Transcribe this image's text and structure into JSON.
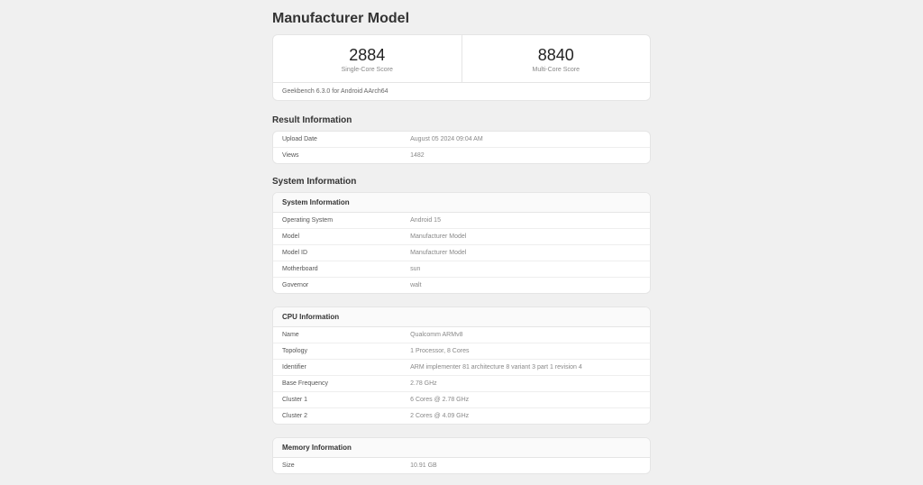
{
  "title": "Manufacturer Model",
  "scores": {
    "single_core": {
      "value": "2884",
      "label": "Single-Core Score"
    },
    "multi_core": {
      "value": "8840",
      "label": "Multi-Core Score"
    }
  },
  "version_text": "Geekbench 6.3.0 for Android AArch64",
  "sections": {
    "result": {
      "title": "Result Information",
      "rows": [
        {
          "label": "Upload Date",
          "value": "August 05 2024 09:04 AM"
        },
        {
          "label": "Views",
          "value": "1482"
        }
      ]
    },
    "system": {
      "title": "System Information",
      "header": "System Information",
      "rows": [
        {
          "label": "Operating System",
          "value": "Android 15"
        },
        {
          "label": "Model",
          "value": "Manufacturer Model"
        },
        {
          "label": "Model ID",
          "value": "Manufacturer Model"
        },
        {
          "label": "Motherboard",
          "value": "sun"
        },
        {
          "label": "Governor",
          "value": "walt"
        }
      ]
    },
    "cpu": {
      "header": "CPU Information",
      "rows": [
        {
          "label": "Name",
          "value": "Qualcomm ARMv8"
        },
        {
          "label": "Topology",
          "value": "1 Processor, 8 Cores"
        },
        {
          "label": "Identifier",
          "value": "ARM implementer 81 architecture 8 variant 3 part 1 revision 4"
        },
        {
          "label": "Base Frequency",
          "value": "2.78 GHz"
        },
        {
          "label": "Cluster 1",
          "value": "6 Cores @ 2.78 GHz"
        },
        {
          "label": "Cluster 2",
          "value": "2 Cores @ 4.09 GHz"
        }
      ]
    },
    "memory": {
      "header": "Memory Information",
      "rows": [
        {
          "label": "Size",
          "value": "10.91 GB"
        }
      ]
    }
  }
}
